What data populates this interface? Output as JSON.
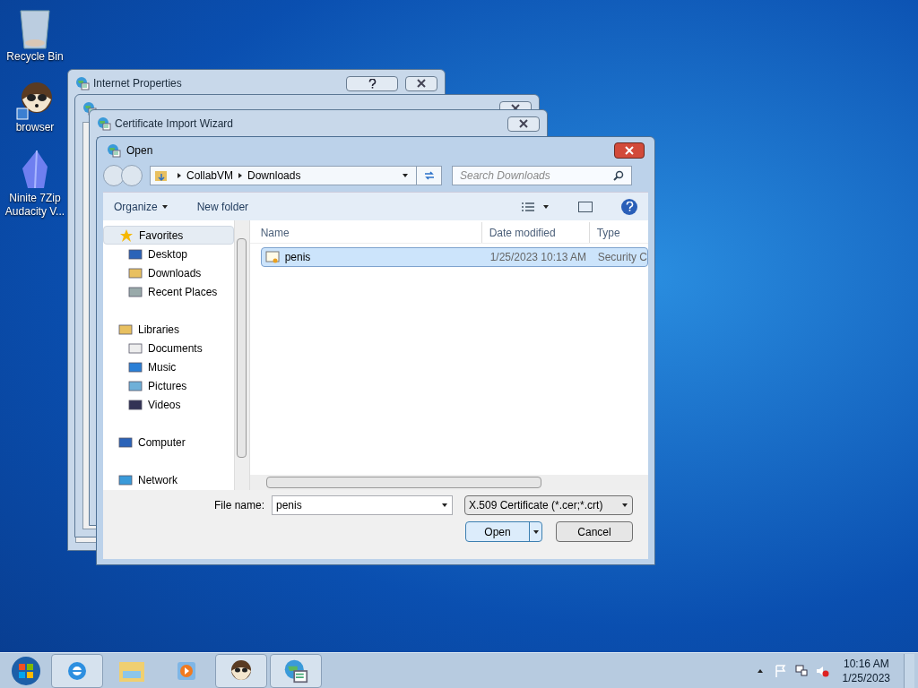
{
  "desktop_icons": [
    {
      "kind": "bin",
      "label": "Recycle Bin"
    },
    {
      "kind": "raccoon",
      "label": "browser"
    },
    {
      "kind": "crystal",
      "label": "Ninite 7Zip Audacity V..."
    }
  ],
  "background_windows": [
    {
      "title": "Internet Properties",
      "help": true
    },
    {
      "help": false
    },
    {
      "title": "Certificate Import Wizard",
      "help": false
    }
  ],
  "open_dialog": {
    "title": "Open",
    "breadcrumb": [
      "CollabVM",
      "Downloads"
    ],
    "search": {
      "placeholder": "Search Downloads"
    },
    "toolbar": {
      "organize": "Organize",
      "new_folder": "New folder"
    },
    "nav": [
      {
        "kind": "star",
        "label": "Favorites",
        "selected": true,
        "children": [
          {
            "kind": "desktop",
            "label": "Desktop",
            "selected": false
          },
          {
            "kind": "download",
            "label": "Downloads",
            "selected": false
          },
          {
            "kind": "recent",
            "label": "Recent Places",
            "selected": false
          }
        ]
      },
      {
        "kind": "library",
        "label": "Libraries",
        "selected": false,
        "children": [
          {
            "kind": "doc",
            "label": "Documents",
            "selected": false
          },
          {
            "kind": "music",
            "label": "Music",
            "selected": false
          },
          {
            "kind": "picture",
            "label": "Pictures",
            "selected": false
          },
          {
            "kind": "video",
            "label": "Videos",
            "selected": false
          }
        ]
      },
      {
        "kind": "computer",
        "label": "Computer",
        "selected": false
      },
      {
        "kind": "network",
        "label": "Network",
        "selected": false
      }
    ],
    "columns": [
      "Name",
      "Date modified",
      "Type"
    ],
    "files": [
      {
        "name": "penis",
        "date": "1/25/2023 10:13 AM",
        "type": "Security C",
        "selected": true
      }
    ],
    "file_name": {
      "label": "File name:",
      "value": "penis"
    },
    "file_type": "X.509 Certificate (*.cer;*.crt)",
    "buttons": {
      "open": "Open",
      "cancel": "Cancel"
    }
  },
  "taskbar": {
    "items": [
      {
        "kind": "ie",
        "selected": true
      },
      {
        "kind": "folder",
        "selected": false
      },
      {
        "kind": "media",
        "selected": false
      },
      {
        "kind": "raccoon",
        "selected": true
      },
      {
        "kind": "cert",
        "selected": true
      }
    ],
    "time": "10:16 AM",
    "date": "1/25/2023"
  }
}
